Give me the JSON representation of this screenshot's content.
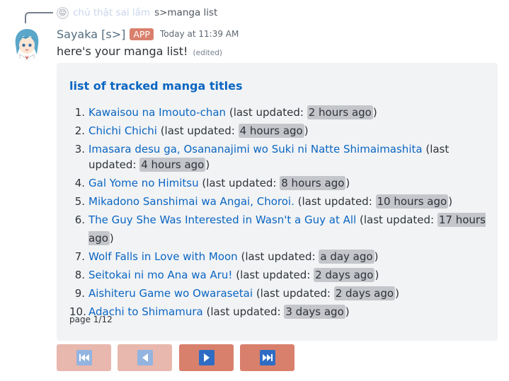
{
  "reply": {
    "name": "chú thật sai lầm",
    "content": "s>manga list"
  },
  "message": {
    "username": "Sayaka [s>]",
    "tag": "APP",
    "timestamp": "Today at 11:39 AM",
    "text": "here's your manga list!",
    "edited": "(edited)"
  },
  "embed": {
    "title": "list of tracked manga titles",
    "prefix": "(last updated: ",
    "suffix": ")",
    "items": [
      {
        "n": "1.",
        "title": "Kawaisou na Imouto-chan",
        "updated": "2 hours ago"
      },
      {
        "n": "2.",
        "title": "Chichi Chichi",
        "updated": "4 hours ago"
      },
      {
        "n": "3.",
        "title": "Imasara desu ga, Osananajimi wo Suki ni Natte Shimaimashita",
        "updated": "4 hours ago"
      },
      {
        "n": "4.",
        "title": "Gal Yome no Himitsu",
        "updated": "8 hours ago"
      },
      {
        "n": "5.",
        "title": "Mikadono Sanshimai wa Angai, Choroi.",
        "updated": "10 hours ago"
      },
      {
        "n": "6.",
        "title": "The Guy She Was Interested in Wasn't a Guy at All",
        "updated": "17 hours ago"
      },
      {
        "n": "7.",
        "title": "Wolf Falls in Love with Moon",
        "updated": "a day ago"
      },
      {
        "n": "8.",
        "title": "Seitokai ni mo Ana wa Aru!",
        "updated": "2 days ago"
      },
      {
        "n": "9.",
        "title": "Aishiteru Game wo Owarasetai",
        "updated": "2 days ago"
      },
      {
        "n": "10.",
        "title": "Adachi to Shimamura",
        "updated": "3 days ago"
      }
    ],
    "footer": "page 1/12"
  },
  "buttons": [
    {
      "icon": "first-page-icon",
      "enabled": false
    },
    {
      "icon": "previous-page-icon",
      "enabled": false
    },
    {
      "icon": "next-page-icon",
      "enabled": true
    },
    {
      "icon": "last-page-icon",
      "enabled": true
    }
  ],
  "colors": {
    "link": "#0a66c2",
    "app_tag": "#d9806d",
    "button_active": "#d9806d",
    "button_disabled": "#e8b7ad",
    "embed_bg": "#f2f3f5"
  }
}
